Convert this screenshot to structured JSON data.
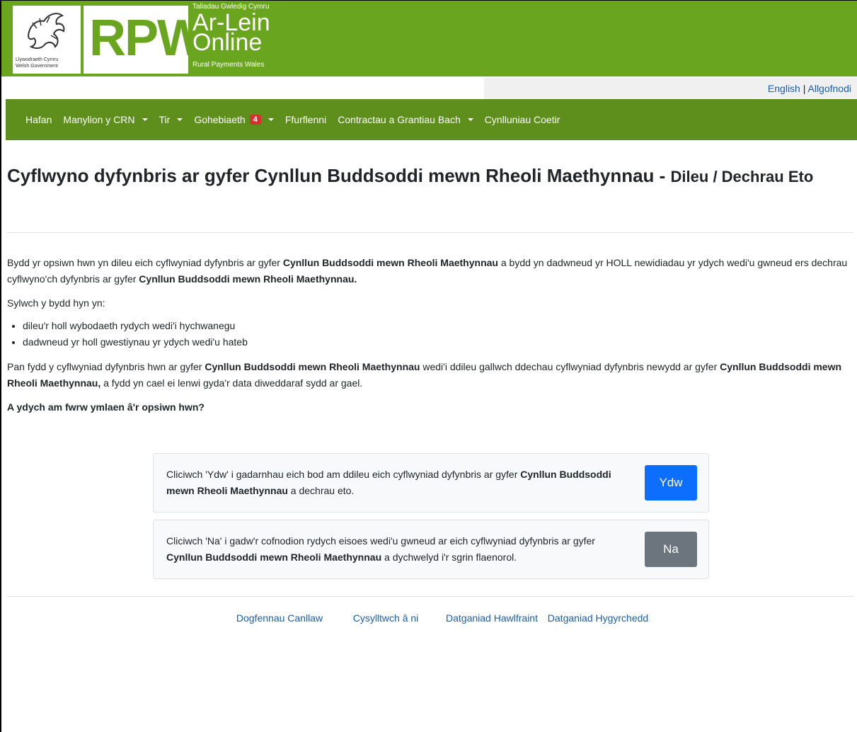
{
  "header": {
    "gov_text_line1": "Llywodraeth Cymru",
    "gov_text_line2": "Welsh Government",
    "rpw": "RPW",
    "brand_small": "Taliadau Gwledig Cymru",
    "brand_line1": "Ar-Lein",
    "brand_line2": "Online",
    "brand_foot": "Rural Payments Wales",
    "brand_color": "#6aa51f"
  },
  "lang": {
    "english": "English",
    "separator": " | ",
    "logout": "Allgofnodi"
  },
  "nav": {
    "items": [
      {
        "label": "Hafan",
        "dropdown": false
      },
      {
        "label": "Manylion y CRN",
        "dropdown": true
      },
      {
        "label": "Tir",
        "dropdown": true
      },
      {
        "label": "Gohebiaeth",
        "dropdown": true,
        "badge": "4"
      },
      {
        "label": "Ffurflenni",
        "dropdown": false
      },
      {
        "label": "Contractau a Grantiau Bach",
        "dropdown": true
      },
      {
        "label": "Cynlluniau Coetir",
        "dropdown": false
      }
    ],
    "color": "#5e8f1c"
  },
  "page": {
    "title": "Cyflwyno dyfynbris ar gyfer Cynllun Buddsoddi mewn Rheoli Maethynnau -",
    "subtitle": "Dileu / Dechrau Eto"
  },
  "body": {
    "p1_a": "Bydd yr opsiwn hwn yn dileu eich cyflwyniad dyfynbris ar gyfer ",
    "p1_b": "Cynllun Buddsoddi mewn Rheoli Maethynnau",
    "p1_c": " a bydd yn dadwneud yr HOLL newidiadau yr ydych wedi'u gwneud ers dechrau cyflwyno'ch dyfynbris ar gyfer ",
    "p1_d": "Cynllun Buddsoddi mewn Rheoli Maethynnau.",
    "p2": "Sylwch y bydd hyn yn:",
    "bullets": [
      "dileu'r holl wybodaeth rydych wedi'i hychwanegu",
      "dadwneud yr holl gwestiynau yr ydych wedi'u hateb"
    ],
    "p3_a": "Pan fydd y cyflwyniad dyfynbris hwn ar gyfer ",
    "p3_b": "Cynllun Buddsoddi mewn Rheoli Maethynnau",
    "p3_c": " wedi'i ddileu gallwch ddechau cyflwyniad dyfynbris newydd ar gyfer ",
    "p3_d": "Cynllun Buddsoddi mewn Rheoli Maethynnau,",
    "p3_e": " a fydd yn cael ei lenwi gyda'r data diweddaraf sydd ar gael.",
    "question": "A ydych am fwrw ymlaen â'r opsiwn hwn?"
  },
  "card_yes": {
    "text_a": "Cliciwch 'Ydw' i gadarnhau eich bod am ddileu eich cyflwyniad dyfynbris ar gyfer ",
    "text_b": "Cynllun Buddsoddi mewn Rheoli Maethynnau",
    "text_c": " a dechrau eto.",
    "button": "Ydw",
    "button_color": "#0d6efd"
  },
  "card_no": {
    "text_a": "Cliciwch 'Na' i gadw'r cofnodion rydych eisoes wedi'u gwneud ar eich cyflwyniad dyfynbris ar gyfer ",
    "text_b": "Cynllun Buddsoddi mewn Rheoli Maethynnau",
    "text_c": " a dychwelyd i'r sgrin flaenorol.",
    "button": "Na",
    "button_color": "#6c757d"
  },
  "footer": {
    "links": [
      "Dogfennau Canllaw",
      "Cysylltwch â ni",
      "Datganiad Hawlfraint",
      "Datganiad Hygyrchedd"
    ]
  }
}
